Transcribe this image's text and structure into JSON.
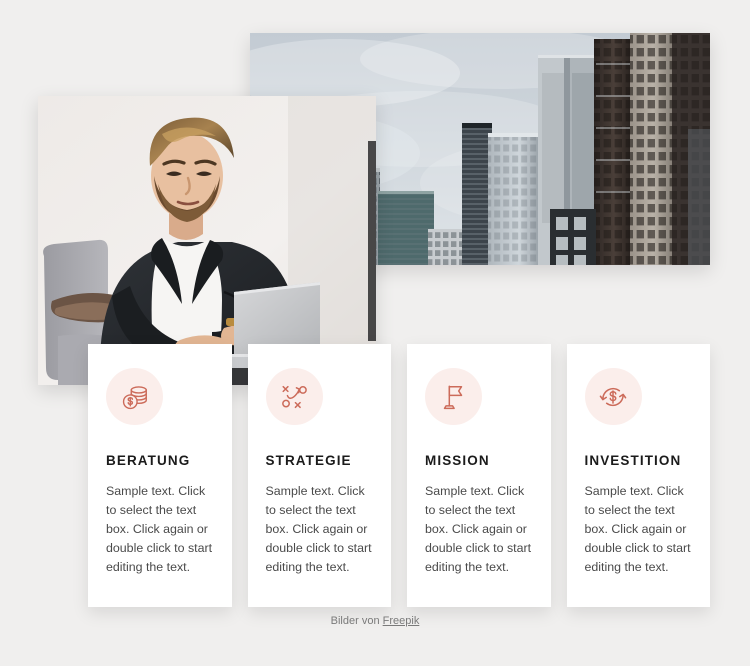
{
  "page": {
    "background_color": "#f0efee",
    "accent_color": "#cc6b5a",
    "icon_circle_color": "#fbeeeb"
  },
  "media": [
    {
      "name": "skyline-photo",
      "alt": "City skyline with modern glass office towers under an overcast sky"
    },
    {
      "name": "person-photo",
      "alt": "Bearded businessman in a dark blazer and white t-shirt working on a laptop"
    }
  ],
  "cards": [
    {
      "icon": "coins-stack-icon",
      "title": "BERATUNG",
      "text": "Sample text. Click to select the text box. Click again or double click to start editing the text."
    },
    {
      "icon": "strategy-playbook-icon",
      "title": "STRATEGIE",
      "text": "Sample text. Click to select the text box. Click again or double click to start editing the text."
    },
    {
      "icon": "flag-icon",
      "title": "MISSION",
      "text": "Sample text. Click to select the text box. Click again or double click to start editing the text."
    },
    {
      "icon": "money-refresh-icon",
      "title": "INVESTITION",
      "text": "Sample text. Click to select the text box. Click again or double click to start editing the text."
    }
  ],
  "credit": {
    "prefix": "Bilder von ",
    "link_label": "Freepik"
  }
}
